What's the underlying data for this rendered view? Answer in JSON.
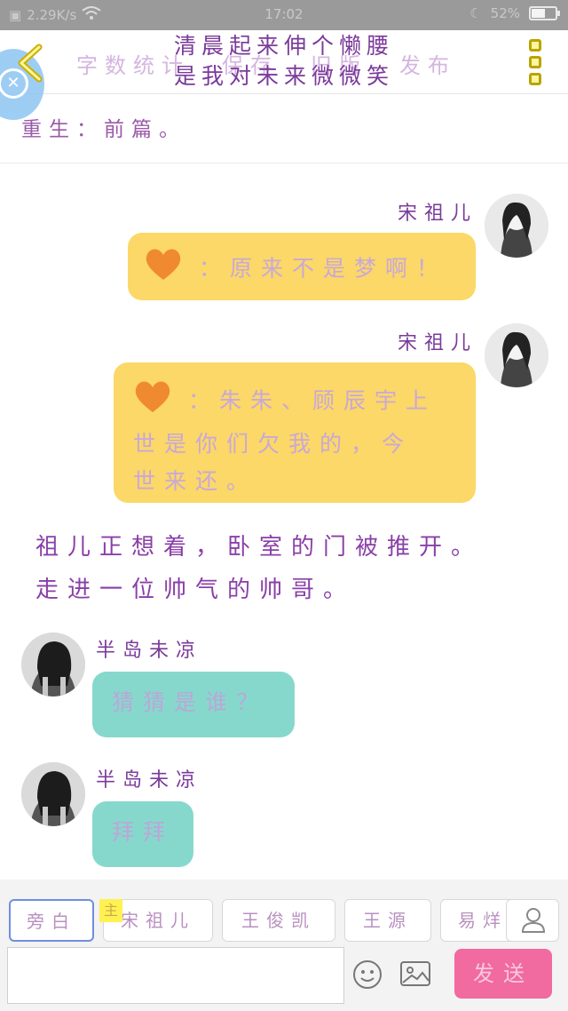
{
  "status_bar": {
    "speed": "2.29K/s",
    "time": "17:02",
    "battery": "52%",
    "battery_level": 0.52
  },
  "header": {
    "menu": [
      "字数统计",
      "保存",
      "旧版",
      "发布"
    ],
    "overlay_title_lines": [
      "清晨起来伸个懒腰",
      "是我对未来微微笑"
    ]
  },
  "chapter_title": "重生：前篇。",
  "messages": {
    "m1": {
      "name": "宋祖儿",
      "text": "：原来不是梦啊！"
    },
    "m2": {
      "name": "宋祖儿",
      "line1": "：朱朱、顾辰宇上",
      "line2": "世是你们欠我的，今",
      "line3": "世来还。"
    },
    "narration_line1": "祖儿正想着，卧室的门被推开。",
    "narration_line2": "走进一位帅气的帅哥。",
    "m3": {
      "name": "半岛未凉",
      "text": "猜猜是谁？"
    },
    "m4": {
      "name": "半岛未凉",
      "text": "拜拜"
    }
  },
  "composer": {
    "roles": [
      "旁白",
      "宋祖儿",
      "王俊凯",
      "王源",
      "易烊"
    ],
    "main_tag": "主",
    "send_label": "发送"
  },
  "colors": {
    "accent_yellow": "#fbd867",
    "accent_teal": "#87d8cc",
    "send_pink": "#f16aa0"
  }
}
